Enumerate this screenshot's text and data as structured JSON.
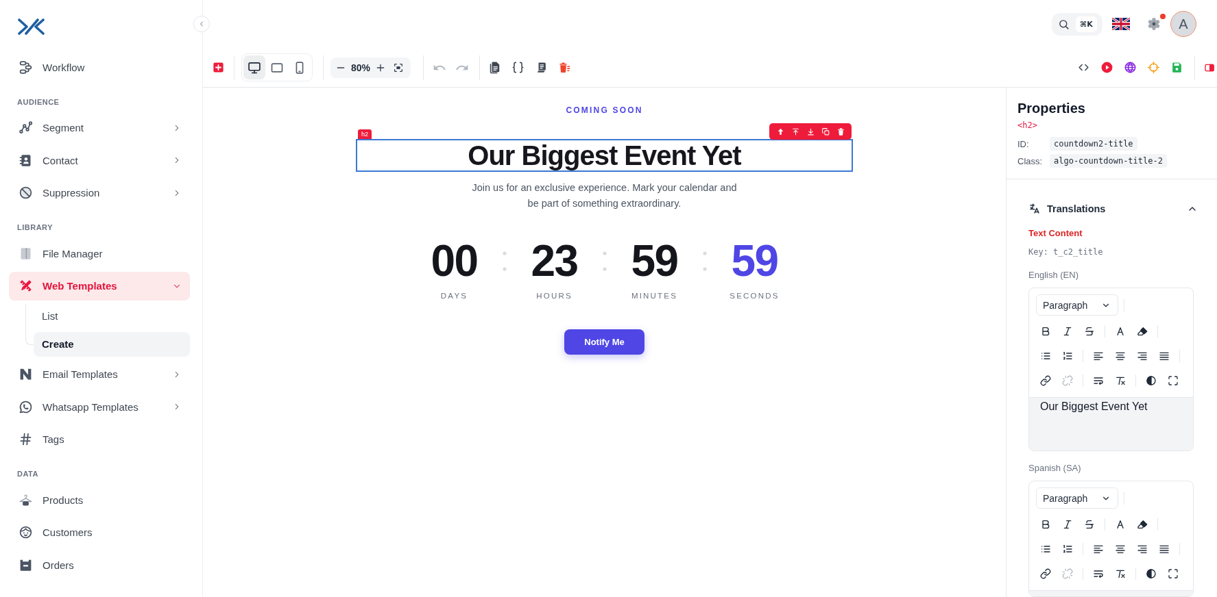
{
  "sidebar": {
    "sections": [
      {
        "items": [
          {
            "kind": "link",
            "label": "Workflow",
            "selected": false
          }
        ]
      },
      {
        "heading": "AUDIENCE",
        "items": [
          {
            "kind": "menu",
            "label": "Segment",
            "selected": false,
            "expanded": false
          },
          {
            "kind": "menu",
            "label": "Contact",
            "selected": false,
            "expanded": false
          },
          {
            "kind": "menu",
            "label": "Suppression",
            "selected": false,
            "expanded": false
          }
        ]
      },
      {
        "heading": "LIBRARY",
        "items": [
          {
            "kind": "link",
            "label": "File Manager",
            "selected": false
          },
          {
            "kind": "menu",
            "label": "Web Templates",
            "selected": true,
            "expanded": true,
            "children": [
              {
                "label": "List",
                "selected": false
              },
              {
                "label": "Create",
                "selected": true
              }
            ]
          },
          {
            "kind": "menu",
            "label": "Email Templates",
            "selected": false,
            "expanded": false
          },
          {
            "kind": "menu",
            "label": "Whatsapp Templates",
            "selected": false,
            "expanded": false
          },
          {
            "kind": "link",
            "label": "Tags",
            "selected": false
          }
        ]
      },
      {
        "heading": "DATA",
        "items": [
          {
            "kind": "link",
            "label": "Products",
            "selected": false
          },
          {
            "kind": "link",
            "label": "Customers",
            "selected": false
          },
          {
            "kind": "link",
            "label": "Orders",
            "selected": false
          }
        ]
      }
    ]
  },
  "topbar": {
    "search_shortcut": "⌘K",
    "notification": true,
    "avatar_initial": "A"
  },
  "toolbar": {
    "devices": [
      {
        "selected": true
      },
      {
        "selected": false
      },
      {
        "selected": false
      }
    ],
    "zoom": "80%",
    "history": [
      {
        "disabled": true
      },
      {
        "disabled": true
      }
    ]
  },
  "canvas": {
    "eyebrow": "COMING SOON",
    "title": {
      "text": "Our Biggest Event Yet",
      "tag": "h2",
      "selected": true
    },
    "description": "Join us for an exclusive experience. Mark your calendar and be part of something extraordinary.",
    "countdown": [
      {
        "value": "00",
        "label": "DAYS",
        "highlight": false
      },
      {
        "value": "23",
        "label": "HOURS",
        "highlight": false
      },
      {
        "value": "59",
        "label": "MINUTES",
        "highlight": false
      },
      {
        "value": "59",
        "label": "SECONDS",
        "highlight": true
      }
    ],
    "button": "Notify Me"
  },
  "properties": {
    "title": "Properties",
    "tag": "<h2>",
    "attributes": [
      {
        "label": "ID:",
        "value": "countdown2-title"
      },
      {
        "label": "Class:",
        "value": "algo-countdown-title-2"
      }
    ],
    "translations": {
      "title": "Translations",
      "expanded": true,
      "section": "Text Content",
      "key": "Key: t_c2_title",
      "languages": [
        {
          "label": "English (EN)",
          "format": "Paragraph",
          "content": "Our Biggest Event Yet",
          "unlink_disabled": true
        },
        {
          "label": "Spanish (SA)",
          "format": "Paragraph",
          "unlink_disabled": true
        }
      ]
    }
  }
}
